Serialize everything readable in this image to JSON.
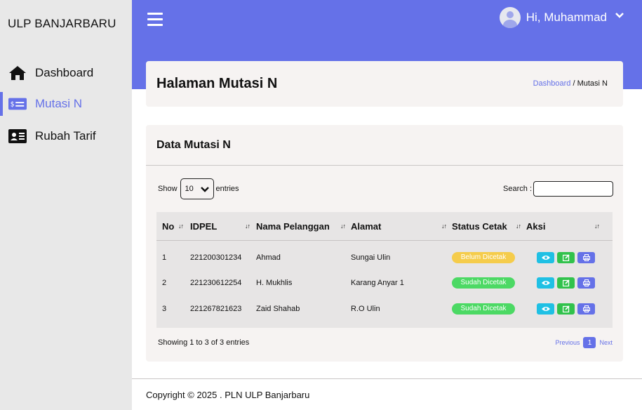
{
  "sidebar": {
    "brand": "ULP BANJARBARU",
    "items": [
      {
        "label": "Dashboard",
        "icon": "home-icon"
      },
      {
        "label": "Mutasi N",
        "icon": "money-bill-icon",
        "active": true
      },
      {
        "label": "Rubah Tarif",
        "icon": "id-card-icon"
      }
    ]
  },
  "header": {
    "greeting": "Hi, Muhammad",
    "menu_icon": "hamburger-icon",
    "avatar_icon": "user-avatar-icon",
    "dropdown_icon": "chevron-down-icon"
  },
  "page": {
    "title": "Halaman Mutasi N",
    "breadcrumb": {
      "link": "Dashboard",
      "separator": " / ",
      "current": "Mutasi N"
    }
  },
  "data_card": {
    "title": "Data Mutasi N",
    "show_label": "Show",
    "entries_value": "10",
    "entries_label": "entries",
    "search_label": "Search :",
    "search_value": "",
    "columns": [
      "No",
      "IDPEL",
      "Nama Pelanggan",
      "Alamat",
      "Status Cetak",
      "Aksi"
    ],
    "rows": [
      {
        "no": "1",
        "idpel": "221200301234",
        "nama": "Ahmad",
        "alamat": "Sungai Ulin",
        "status": "Belum Dicetak",
        "status_type": "warning"
      },
      {
        "no": "2",
        "idpel": "221230612254",
        "nama": "H. Mukhlis",
        "alamat": "Karang Anyar 1",
        "status": "Sudah Dicetak",
        "status_type": "success"
      },
      {
        "no": "3",
        "idpel": "221267821623",
        "nama": "Zaid Shahab",
        "alamat": "R.O Ulin",
        "status": "Sudah Dicetak",
        "status_type": "success"
      }
    ],
    "info": "Showing 1 to 3 of 3 entries",
    "pagination": {
      "previous": "Previous",
      "current": "1",
      "next": "Next"
    }
  },
  "footer": {
    "text": "Copyright © 2025 . PLN ULP Banjarbaru"
  },
  "colors": {
    "primary": "#6571e8",
    "warning": "#f5cc4b",
    "success": "#4cd964",
    "info": "#1fc0e4",
    "edit": "#31c24c"
  }
}
